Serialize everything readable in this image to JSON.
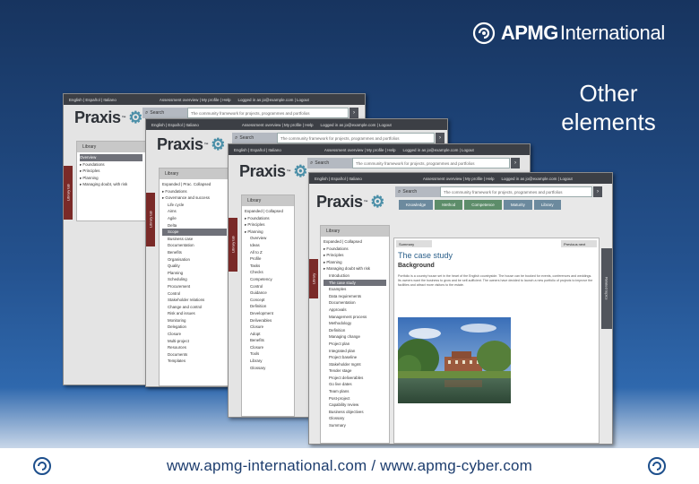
{
  "brand": {
    "name_strong": "APMG",
    "name_light": "International",
    "logo_icon": "apmg-swirl-icon"
  },
  "caption": {
    "line1": "Other",
    "line2": "elements"
  },
  "footer": {
    "url": "www.apmg-international.com / www.apmg-cyber.com"
  },
  "screens": {
    "topbar_left": "English | Español | Italiano",
    "topbar_mid": "Assessment overview | My profile | Help",
    "topbar_right": "Logged in as jo@example.com | Logout",
    "search_label": "Search",
    "search_placeholder": "The community framework for projects, programmes and portfolios",
    "logo": "Praxis",
    "library": "Library",
    "shot1_tree": [
      "Overview",
      "Foundations",
      "Principles",
      "Planning",
      "Managing doubt, with risk"
    ],
    "shot2_tree": [
      "Expanded | Prac. Collapsed",
      "Foundations",
      "Governance and success",
      "Life cycle",
      "Aims",
      "Agile",
      "Delta",
      "Scope",
      "Business case",
      "Documentation",
      "Benefits",
      "Organisation",
      "Quality",
      "Planning",
      "Scheduling",
      "Procurement",
      "Control",
      "Stakeholder relations",
      "Change and control",
      "Risk and issues",
      "Monitoring",
      "Delegation",
      "Closure",
      "Multi-project",
      "Resources",
      "Documents",
      "Templates"
    ],
    "shot3_tree": [
      "Expanded | Collapsed",
      "Foundations",
      "Principles",
      "Planning",
      "Overview",
      "Ideas",
      "All to Z",
      "Profile",
      "Tasks",
      "Checks",
      "Competency",
      "Control",
      "Guidance",
      "Concept",
      "Definition",
      "Development",
      "Deliverables",
      "Closure",
      "Adopt",
      "Benefits",
      "Closure",
      "Tools",
      "Library",
      "Glossary"
    ],
    "shot4_nav": [
      "Knowledge",
      "Method",
      "Competence",
      "Maturity",
      "Library"
    ],
    "shot4_tree": [
      "Expanded | Collapsed",
      "Foundations",
      "Principles",
      "Planning",
      "Managing doubt with risk",
      "Introduction",
      "The case study",
      "Examples",
      "Data requirements",
      "Documentation",
      "Approvals",
      "Management process",
      "Methodology",
      "Definition",
      "Managing change",
      "Project plan",
      "Integrated plan",
      "Project baseline",
      "Stakeholder mgmt",
      "Tender stage",
      "Project deliverables",
      "Go live dates",
      "Team plans",
      "Post-project",
      "Capability review",
      "Business objectives",
      "Glossary",
      "Summary"
    ],
    "shot4_title": "The case study",
    "shot4_subtitle": "Background",
    "shot4_body": "Portfolio is a country house set in the heart of the English countryside. The house can be booked for events, conferences and weddings. Its owners want the business to grow and be self-sufficient. The owners have decided to launch a new portfolio of projects to improve the facilities and attract more visitors to the estate.",
    "shot4_tab_right": "Previous next",
    "shot4_summary": "Summary",
    "shot4_side_tab": "Related topics"
  },
  "colors": {
    "bg_top": "#17345f",
    "bg_bottom": "#2f68ad",
    "maroon_tab": "#7a2a28",
    "dark_bar": "#3c3f45"
  }
}
